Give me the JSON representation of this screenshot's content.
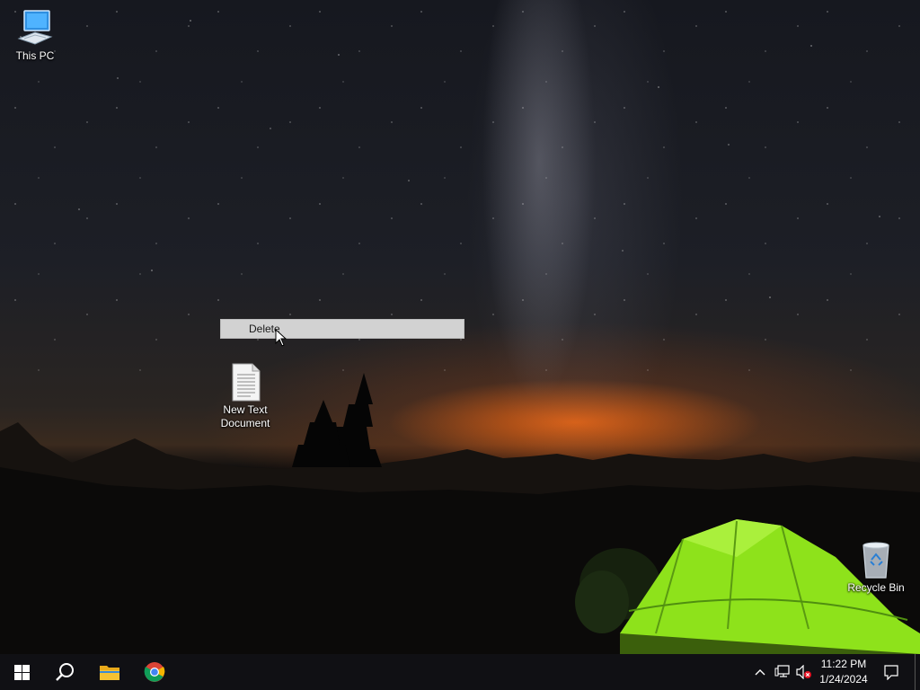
{
  "desktop": {
    "icons": [
      {
        "label": "This PC",
        "icon": "computer-icon"
      },
      {
        "label": "New Text Document",
        "icon": "text-file-icon"
      },
      {
        "label": "Recycle Bin",
        "icon": "recycle-bin-icon"
      }
    ]
  },
  "context_menu": {
    "item_label": "Delete"
  },
  "taskbar": {
    "pinned": [
      {
        "name": "Start",
        "icon": "windows-start-icon"
      },
      {
        "name": "Search",
        "icon": "search-icon"
      },
      {
        "name": "File Explorer",
        "icon": "folder-icon"
      },
      {
        "name": "Google Chrome",
        "icon": "chrome-icon"
      }
    ],
    "tray": {
      "icons": [
        "chevron-up-icon",
        "network-icon",
        "speaker-muted-icon",
        "notification-icon"
      ],
      "time": "11:22 PM",
      "date": "1/24/2024"
    }
  },
  "colors": {
    "taskbar_bg": "#101014",
    "context_highlight": "#d2d2d2",
    "tent_green": "#8ee21b",
    "sunset_glow": "#ff6e14"
  }
}
